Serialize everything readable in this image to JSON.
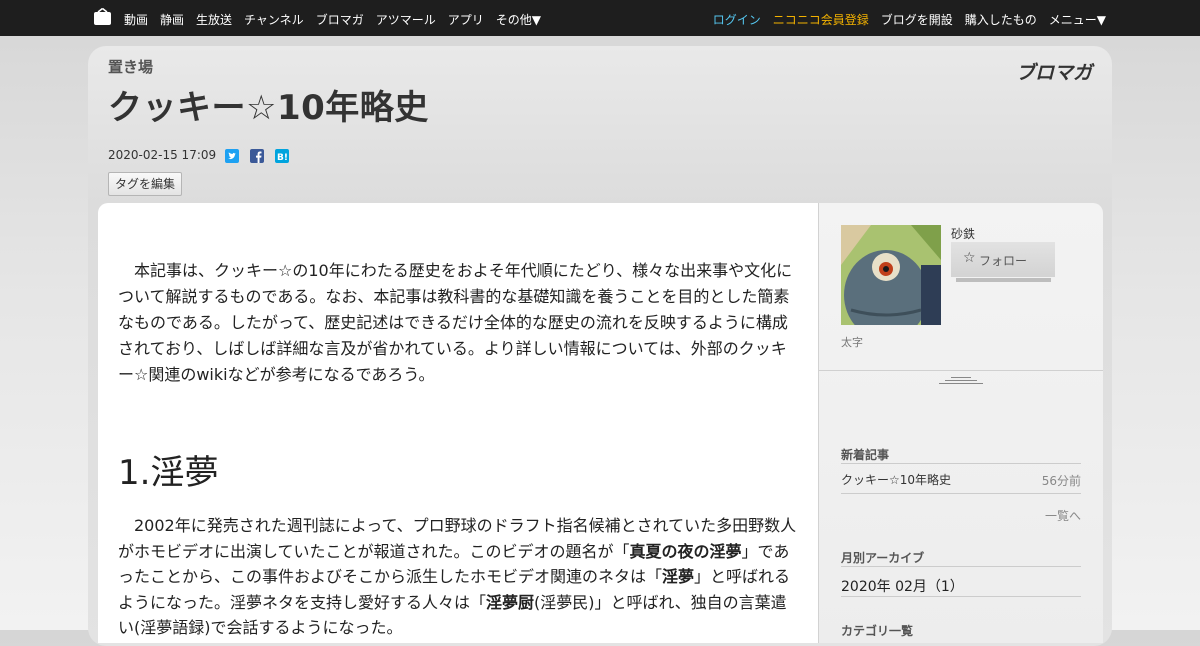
{
  "topnav": {
    "left": [
      "動画",
      "静画",
      "生放送",
      "チャンネル",
      "ブロマガ",
      "アツマール",
      "アプリ",
      "その他▼"
    ],
    "login": "ログイン",
    "register": "ニコニコ会員登録",
    "right": [
      "ブログを開設",
      "購入したもの",
      "メニュー▼"
    ]
  },
  "header": {
    "blog_name": "置き場",
    "title": "クッキー☆10年略史",
    "brand": "ブロマガ",
    "date": "2020-02-15 17:09",
    "tag_edit": "タグを編集"
  },
  "article": {
    "intro": "本記事は、クッキー☆の10年にわたる歴史をおよそ年代順にたどり、様々な出来事や文化について解説するものである。なお、本記事は教科書的な基礎知識を養うことを目的とした簡素なものである。したがって、歴史記述はできるだけ全体的な歴史の流れを反映するように構成されており、しばしば詳細な言及が省かれている。より詳しい情報については、外部のクッキー☆関連のwikiなどが参考になるであろう。",
    "section1_heading": "1.淫夢",
    "section1_body_a": "2002年に発売された週刊誌によって、プロ野球のドラフト指名候補とされていた多田野数人がホモビデオに出演していたことが報道された。このビデオの題名が「",
    "section1_bold1": "真夏の夜の淫夢",
    "section1_body_b": "」であったことから、この事件およびそこから派生したホモビデオ関連のネタは「",
    "section1_bold2": "淫夢",
    "section1_body_c": "」と呼ばれるようになった。淫夢ネタを支持し愛好する人々は「",
    "section1_bold3": "淫夢厨",
    "section1_body_d": "(淫夢民)」と呼ばれ、独自の言葉遣い(淫夢語録)で会話するようになった。"
  },
  "sidebar": {
    "author_name": "砂鉄",
    "follow": "フォロー",
    "avatar_caption": "太字",
    "recent_title": "新着記事",
    "recent_item": "クッキー☆10年略史",
    "recent_time": "56分前",
    "more": "一覧へ",
    "archive_title": "月別アーカイブ",
    "archive_item": "2020年 02月（1）",
    "category_title": "カテゴリ一覧"
  }
}
